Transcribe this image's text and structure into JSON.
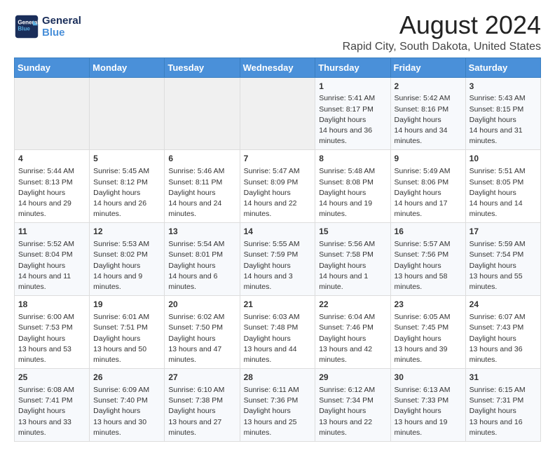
{
  "header": {
    "logo_line1": "General",
    "logo_line2": "Blue",
    "title": "August 2024",
    "subtitle": "Rapid City, South Dakota, United States"
  },
  "weekdays": [
    "Sunday",
    "Monday",
    "Tuesday",
    "Wednesday",
    "Thursday",
    "Friday",
    "Saturday"
  ],
  "weeks": [
    [
      {
        "day": "",
        "empty": true
      },
      {
        "day": "",
        "empty": true
      },
      {
        "day": "",
        "empty": true
      },
      {
        "day": "",
        "empty": true
      },
      {
        "day": "1",
        "rise": "5:41 AM",
        "set": "8:17 PM",
        "daylight": "14 hours and 36 minutes."
      },
      {
        "day": "2",
        "rise": "5:42 AM",
        "set": "8:16 PM",
        "daylight": "14 hours and 34 minutes."
      },
      {
        "day": "3",
        "rise": "5:43 AM",
        "set": "8:15 PM",
        "daylight": "14 hours and 31 minutes."
      }
    ],
    [
      {
        "day": "4",
        "rise": "5:44 AM",
        "set": "8:13 PM",
        "daylight": "14 hours and 29 minutes."
      },
      {
        "day": "5",
        "rise": "5:45 AM",
        "set": "8:12 PM",
        "daylight": "14 hours and 26 minutes."
      },
      {
        "day": "6",
        "rise": "5:46 AM",
        "set": "8:11 PM",
        "daylight": "14 hours and 24 minutes."
      },
      {
        "day": "7",
        "rise": "5:47 AM",
        "set": "8:09 PM",
        "daylight": "14 hours and 22 minutes."
      },
      {
        "day": "8",
        "rise": "5:48 AM",
        "set": "8:08 PM",
        "daylight": "14 hours and 19 minutes."
      },
      {
        "day": "9",
        "rise": "5:49 AM",
        "set": "8:06 PM",
        "daylight": "14 hours and 17 minutes."
      },
      {
        "day": "10",
        "rise": "5:51 AM",
        "set": "8:05 PM",
        "daylight": "14 hours and 14 minutes."
      }
    ],
    [
      {
        "day": "11",
        "rise": "5:52 AM",
        "set": "8:04 PM",
        "daylight": "14 hours and 11 minutes."
      },
      {
        "day": "12",
        "rise": "5:53 AM",
        "set": "8:02 PM",
        "daylight": "14 hours and 9 minutes."
      },
      {
        "day": "13",
        "rise": "5:54 AM",
        "set": "8:01 PM",
        "daylight": "14 hours and 6 minutes."
      },
      {
        "day": "14",
        "rise": "5:55 AM",
        "set": "7:59 PM",
        "daylight": "14 hours and 3 minutes."
      },
      {
        "day": "15",
        "rise": "5:56 AM",
        "set": "7:58 PM",
        "daylight": "14 hours and 1 minute."
      },
      {
        "day": "16",
        "rise": "5:57 AM",
        "set": "7:56 PM",
        "daylight": "13 hours and 58 minutes."
      },
      {
        "day": "17",
        "rise": "5:59 AM",
        "set": "7:54 PM",
        "daylight": "13 hours and 55 minutes."
      }
    ],
    [
      {
        "day": "18",
        "rise": "6:00 AM",
        "set": "7:53 PM",
        "daylight": "13 hours and 53 minutes."
      },
      {
        "day": "19",
        "rise": "6:01 AM",
        "set": "7:51 PM",
        "daylight": "13 hours and 50 minutes."
      },
      {
        "day": "20",
        "rise": "6:02 AM",
        "set": "7:50 PM",
        "daylight": "13 hours and 47 minutes."
      },
      {
        "day": "21",
        "rise": "6:03 AM",
        "set": "7:48 PM",
        "daylight": "13 hours and 44 minutes."
      },
      {
        "day": "22",
        "rise": "6:04 AM",
        "set": "7:46 PM",
        "daylight": "13 hours and 42 minutes."
      },
      {
        "day": "23",
        "rise": "6:05 AM",
        "set": "7:45 PM",
        "daylight": "13 hours and 39 minutes."
      },
      {
        "day": "24",
        "rise": "6:07 AM",
        "set": "7:43 PM",
        "daylight": "13 hours and 36 minutes."
      }
    ],
    [
      {
        "day": "25",
        "rise": "6:08 AM",
        "set": "7:41 PM",
        "daylight": "13 hours and 33 minutes."
      },
      {
        "day": "26",
        "rise": "6:09 AM",
        "set": "7:40 PM",
        "daylight": "13 hours and 30 minutes."
      },
      {
        "day": "27",
        "rise": "6:10 AM",
        "set": "7:38 PM",
        "daylight": "13 hours and 27 minutes."
      },
      {
        "day": "28",
        "rise": "6:11 AM",
        "set": "7:36 PM",
        "daylight": "13 hours and 25 minutes."
      },
      {
        "day": "29",
        "rise": "6:12 AM",
        "set": "7:34 PM",
        "daylight": "13 hours and 22 minutes."
      },
      {
        "day": "30",
        "rise": "6:13 AM",
        "set": "7:33 PM",
        "daylight": "13 hours and 19 minutes."
      },
      {
        "day": "31",
        "rise": "6:15 AM",
        "set": "7:31 PM",
        "daylight": "13 hours and 16 minutes."
      }
    ]
  ],
  "labels": {
    "sunrise": "Sunrise:",
    "sunset": "Sunset:",
    "daylight": "Daylight hours"
  }
}
